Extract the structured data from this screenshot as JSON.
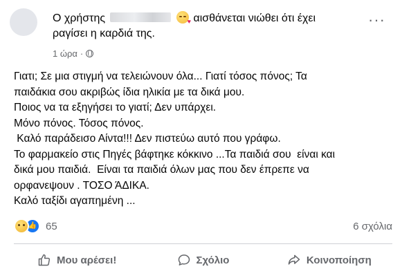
{
  "header": {
    "text_prefix": "Ο χρήστης",
    "text_suffix": "αισθάνεται νιώθει ότι έχει",
    "text_line2": "ραγίσει η καρδιά της.",
    "time": "1 ώρα",
    "dot": "·"
  },
  "post_lines": [
    "Γιατι; Σε μια στιγμή να τελειώνουν όλα... Γιατί τόσος πόνος; Τα",
    "παιδάκια σου ακριβώς ίδια ηλικία με τα δικά μου.",
    "Ποιος να τα εξηγήσει το γιατί; Δεν υπάρχει.",
    "Μόνο πόνος. Τόσος πόνος.",
    " Καλό παράδεισο Αίντα!!! Δεν πιστεύω αυτό που γράφω.",
    "Το φαρμακείο στις Πηγές βάφτηκε κόκκινο ...Τα παιδιά σου  είναι και",
    "δικά μου παιδιά.  Είναι τα παιδιά όλων μας που δεν έπρεπε να",
    "ορφανεψουν . ΤΟΣΟ ΆΔΙΚΑ.",
    "Καλό ταξίδι αγαπημένη ..."
  ],
  "reactions": {
    "count": "65",
    "comments": "6 σχόλια",
    "icons": [
      "sad-reaction-icon",
      "like-reaction-icon"
    ]
  },
  "actions": {
    "like": "Μου αρέσει!",
    "comment": "Σχόλιο",
    "share": "Κοινοποίηση"
  },
  "colors": {
    "text": "#050505",
    "secondary": "#65676b",
    "like_blue": "#1877f2",
    "divider": "#ced0d4"
  }
}
